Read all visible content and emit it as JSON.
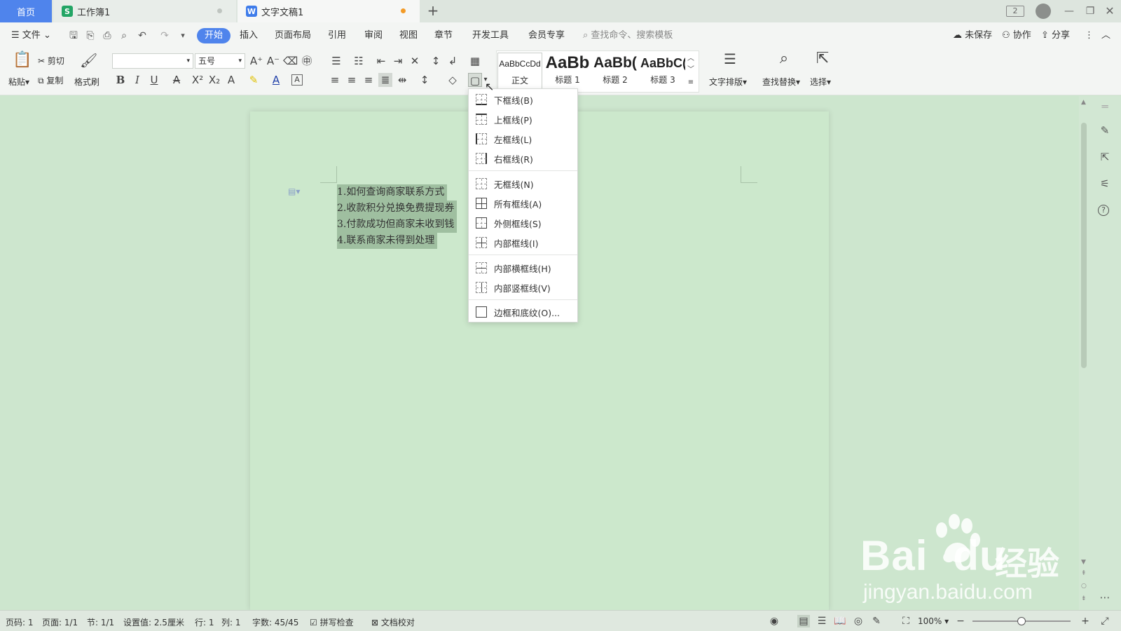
{
  "tabs": {
    "home": "首页",
    "sheet": "工作簿1",
    "doc": "文字文稿1"
  },
  "window": {
    "page_count_badge": "2"
  },
  "menu": {
    "file": "文件",
    "items": [
      "开始",
      "插入",
      "页面布局",
      "引用",
      "审阅",
      "视图",
      "章节",
      "开发工具",
      "会员专享"
    ],
    "search_placeholder": "查找命令、搜索模板",
    "unsaved": "未保存",
    "collab": "协作",
    "share": "分享"
  },
  "ribbon": {
    "paste": "粘贴",
    "cut": "剪切",
    "copy": "复制",
    "format_painter": "格式刷",
    "font_name": "",
    "font_size": "五号",
    "styles": [
      {
        "sample": "AaBbCcDd",
        "name": "正文"
      },
      {
        "sample": "AaBb",
        "name": "标题 1"
      },
      {
        "sample": "AaBb(",
        "name": "标题 2"
      },
      {
        "sample": "AaBbC(",
        "name": "标题 3"
      }
    ],
    "text_layout": "文字排版",
    "find_replace": "查找替换",
    "select": "选择"
  },
  "document": {
    "lines": [
      "1.如何查询商家联系方式",
      "2.收款积分兑换免费提现券",
      "3.付款成功但商家未收到钱",
      "4.联系商家未得到处理"
    ]
  },
  "border_menu": {
    "items": [
      "下框线(B)",
      "上框线(P)",
      "左框线(L)",
      "右框线(R)",
      "无框线(N)",
      "所有框线(A)",
      "外侧框线(S)",
      "内部框线(I)",
      "内部横框线(H)",
      "内部竖框线(V)",
      "边框和底纹(O)..."
    ]
  },
  "status": {
    "page_no": "页码: 1",
    "pages": "页面: 1/1",
    "section": "节: 1/1",
    "setting": "设置值: 2.5厘米",
    "row": "行: 1",
    "col": "列: 1",
    "word_count": "字数: 45/45",
    "spell_check": "拼写检查",
    "doc_proof": "文档校对",
    "zoom": "100%",
    "zoom_level": 0.5
  },
  "watermark": {
    "brand": "Bai",
    "brand_du": "du",
    "cn": "经验",
    "url": "jingyan.baidu.com"
  },
  "colors": {
    "accent": "#4f84ec",
    "doc_bg": "#cce8cc",
    "selection": "#9fbfa0"
  }
}
